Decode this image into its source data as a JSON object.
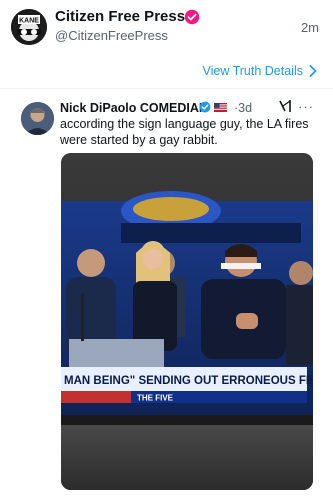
{
  "outer_post": {
    "display_name": "Citizen Free Press",
    "handle": "@CitizenFreePress",
    "timestamp": "2m",
    "avatar_text": "KANE",
    "view_link": "View Truth Details"
  },
  "inner_post": {
    "display_name": "Nick DiPaolo COMEDIAN",
    "timestamp": "3d",
    "separator": "·",
    "text": "according the sign language guy, the LA fires were started by a gay rabbit."
  },
  "media": {
    "chyron_text": "MAN BEING\" SENDING OUT ERRONEOUS FIRE ALERTS",
    "network_label": "THE FIVE"
  },
  "colors": {
    "link": "#1d9bf0",
    "verified": "#f91880",
    "verified_blue": "#1d9bf0",
    "secondary_text": "#536471"
  },
  "icons": [
    "verified-badge-icon",
    "chevron-right-icon",
    "verified-blue-icon",
    "flag-icon",
    "grok-icon",
    "more-icon"
  ]
}
